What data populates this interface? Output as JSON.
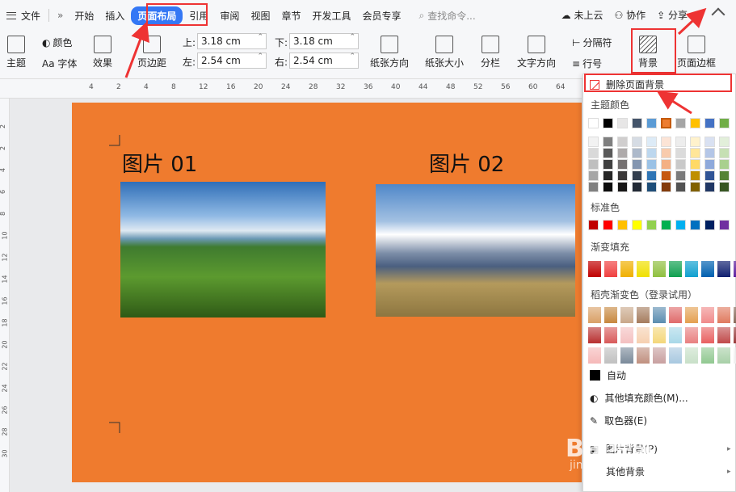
{
  "menu": {
    "file": "文件",
    "items": [
      "开始",
      "插入",
      "页面布局",
      "引用",
      "审阅",
      "视图",
      "章节",
      "开发工具",
      "会员专享"
    ],
    "active": "页面布局",
    "search_placeholder": "查找命令...",
    "right": [
      "未上云",
      "协作",
      "分享"
    ]
  },
  "ribbon": {
    "theme": "主题",
    "color": "颜色",
    "font": "Aa 字体",
    "effect": "效果",
    "margins": "页边距",
    "top_label": "上:",
    "top_value": "3.18 cm",
    "bottom_label": "下:",
    "bottom_value": "3.18 cm",
    "left_label": "左:",
    "left_value": "2.54 cm",
    "right_label": "右:",
    "right_value": "2.54 cm",
    "orientation": "纸张方向",
    "size": "纸张大小",
    "columns": "分栏",
    "text_direction": "文字方向",
    "separator": "分隔符",
    "line_number": "行号",
    "background": "背景",
    "page_border": "页面边框"
  },
  "ruler": [
    "4",
    "2",
    "4",
    "8",
    "12",
    "16",
    "20",
    "24",
    "28",
    "32",
    "36",
    "40",
    "44",
    "48",
    "52",
    "56",
    "60",
    "64"
  ],
  "vruler": [
    "2",
    "2",
    "4",
    "6",
    "8",
    "10",
    "12",
    "14",
    "16",
    "18",
    "20",
    "22",
    "24",
    "26",
    "28",
    "30"
  ],
  "page": {
    "caption1": "图片 01",
    "caption2": "图片 02",
    "background_color": "#ef7b2e"
  },
  "dropdown": {
    "remove_bg": "删除页面背景",
    "theme_colors": "主题颜色",
    "standard_colors": "标准色",
    "gradient_fill": "渐变填充",
    "premium_gradient": "稻壳渐变色（登录试用）",
    "auto": "自动",
    "more_colors": "其他填充颜色(M)...",
    "picker": "取色器(E)",
    "picture_bg": "图片背景(P)",
    "other_bg": "其他背景"
  },
  "watermark": {
    "text": "Bai经验",
    "url": "jingyan.baidu.com"
  }
}
